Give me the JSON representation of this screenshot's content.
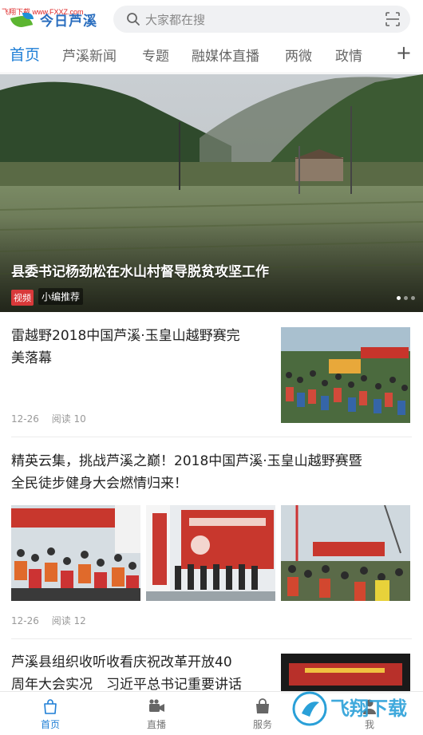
{
  "watermark": "飞翔下载 www.FXXZ.com",
  "header": {
    "app_name": "今日芦溪",
    "search_placeholder": "大家都在搜"
  },
  "tabs": [
    {
      "label": "首页",
      "active": true
    },
    {
      "label": "芦溪新闻",
      "active": false
    },
    {
      "label": "专题",
      "active": false
    },
    {
      "label": "融媒体直播",
      "active": false
    },
    {
      "label": "两微",
      "active": false
    },
    {
      "label": "政情",
      "active": false
    }
  ],
  "tab_plus": "+",
  "hero": {
    "title": "县委书记杨劲松在水山村督导脱贫攻坚工作",
    "badge_video": "视频",
    "badge_pick": "小编推荐",
    "slides": 4,
    "active_slide": 1
  },
  "articles": [
    {
      "title_lines": [
        "雷越野2018中国芦溪·玉皇山越野赛完",
        "美落幕"
      ],
      "date": "12-26",
      "reads": "阅读 10"
    },
    {
      "title_lines": [
        "精英云集，挑战芦溪之巅！2018中国芦溪·玉皇山越野赛暨",
        "全民徒步健身大会燃情归来！"
      ],
      "date": "12-26",
      "reads": "阅读 12"
    },
    {
      "title_lines": [
        "芦溪县组织收听收看庆祝改革开放40",
        "周年大会实况　习近平总书记重要讲话"
      ]
    }
  ],
  "bottom_nav": [
    {
      "label": "首页",
      "icon": "home-bag-icon",
      "active": true
    },
    {
      "label": "直播",
      "icon": "video-camera-icon",
      "active": false
    },
    {
      "label": "服务",
      "icon": "shopping-bag-icon",
      "active": false
    },
    {
      "label": "我",
      "icon": "person-icon",
      "active": false
    }
  ],
  "corner_watermark": "飞翔下载",
  "colors": {
    "accent": "#1f7fd6",
    "badge_red": "#d9393a"
  }
}
